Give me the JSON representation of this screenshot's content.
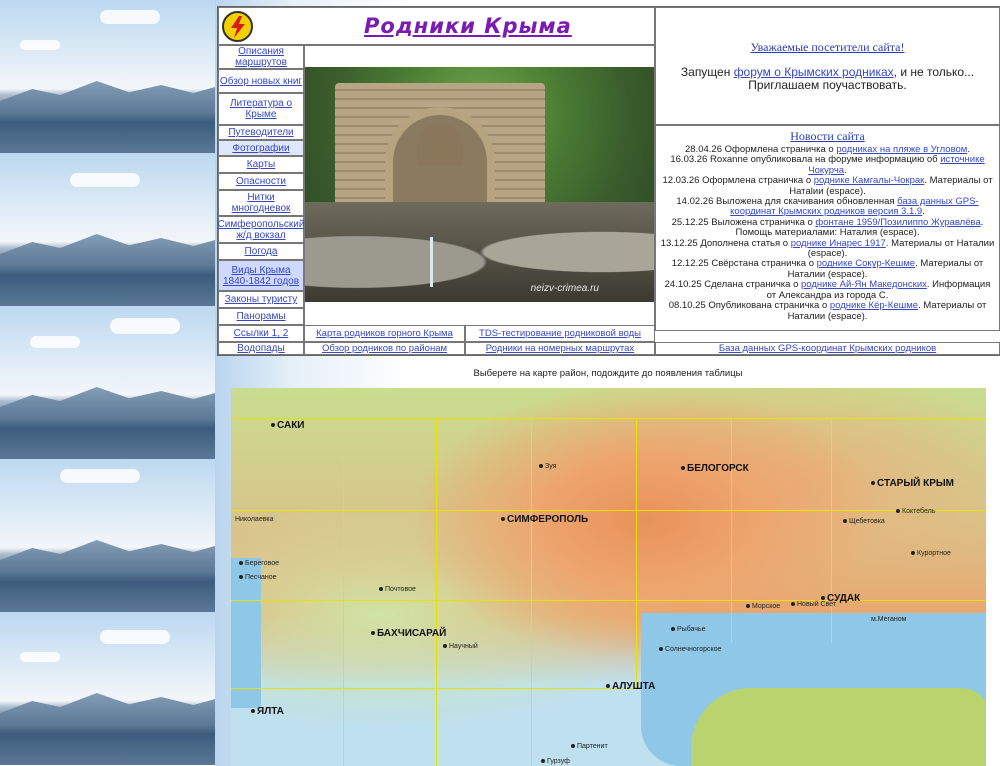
{
  "site": {
    "title": "Родники Крыма"
  },
  "nav": [
    {
      "label": "Описания маршрутов"
    },
    {
      "label": "Обзор новых книг"
    },
    {
      "label": "Литература о Крыме"
    },
    {
      "label": "Путеводители"
    },
    {
      "label": "Фотографии"
    },
    {
      "label": "Карты"
    },
    {
      "label": "Опасности"
    },
    {
      "label": "Нитки многодневок"
    },
    {
      "label": "Симферопольский ж/д вокзал"
    },
    {
      "label": "Погода"
    },
    {
      "label": "Виды Крыма 1840-1842 годов"
    },
    {
      "label": "Законы туристу"
    },
    {
      "label": "Панорамы"
    },
    {
      "label": "Ссылки 1, 2"
    },
    {
      "label": "Водопады"
    }
  ],
  "photo": {
    "watermark": "neizv-crimea.ru"
  },
  "notice": {
    "title": "Уважаемые посетители сайта!",
    "pre": "Запущен ",
    "link": "форум о Крымских родниках",
    "post": ", и не только... Приглашаем поучаствовать."
  },
  "news": {
    "title": "Новости сайта",
    "items": [
      {
        "pre": "28.04.26 Оформлена страничка о ",
        "link": "родниках на пляже в Угловом",
        "post": "."
      },
      {
        "pre": "16.03.26 Roxanne опубликовала на форуме информацию об ",
        "link": "источнике Чокурча",
        "post": "."
      },
      {
        "pre": "12.03.26 Оформлена страничка о ",
        "link": "роднике Камгалы-Чокрак",
        "post": ". Материалы от Натalии (espace)."
      },
      {
        "pre": "14.02.26 Выложена для скачивания обновленная ",
        "link": "база данных GPS-координат Крымских родников версия 3.1.9",
        "post": "."
      },
      {
        "pre": "25.12.25 Выложена страничка о ",
        "link": "фонтане 1959/Позилиппо Журавлёва",
        "post": ". Помощь материалами: Наталия (espace)."
      },
      {
        "pre": "13.12.25 Дополнена статья о ",
        "link": "роднике Инарес 1917",
        "post": ". Материалы от Наталии (espace)."
      },
      {
        "pre": "12.12.25 Свёрстана страничка о ",
        "link": "роднике Сокур-Кешме",
        "post": ". Материалы от Наталии (espace)."
      },
      {
        "pre": "24.10.25 Сделана страничка о ",
        "link": "роднике Ай-Ян Македонских",
        "post": ". Информация от Александра из города С."
      },
      {
        "pre": "08.10.25 Опубликована страничка о ",
        "link": "роднике Кёр-Кешме",
        "post": ". Материалы от Наталии (espace)."
      }
    ]
  },
  "bottom_links": {
    "map_mountain": "Карта родников горного Крыма",
    "tds": "TDS-тестирование родниковой воды",
    "by_region": "Обзор родников по районам",
    "routes": "Родники на номерных маршрутах",
    "gps_db": "База данных GPS-координат Крымских родников"
  },
  "map": {
    "caption": "Выберете на карте район, подождите до появления таблицы",
    "cities": [
      {
        "name": "СИМФЕРОПОЛЬ",
        "big": true
      },
      {
        "name": "БАХЧИСАРАЙ",
        "big": true
      },
      {
        "name": "БЕЛОГОРСК",
        "big": true
      },
      {
        "name": "СТАРЫЙ КРЫМ",
        "big": true
      },
      {
        "name": "СУДАК",
        "big": true
      },
      {
        "name": "АЛУШТА",
        "big": true
      },
      {
        "name": "ЯЛТА",
        "big": true
      },
      {
        "name": "САКИ",
        "big": true
      },
      {
        "name": "Николаевка",
        "big": false
      },
      {
        "name": "Почтовое",
        "big": false
      },
      {
        "name": "Научный",
        "big": false
      },
      {
        "name": "Зуя",
        "big": false
      },
      {
        "name": "Морское",
        "big": false
      },
      {
        "name": "Рыбачье",
        "big": false
      },
      {
        "name": "Солнечногорское",
        "big": false
      },
      {
        "name": "Партенит",
        "big": false
      },
      {
        "name": "Гурзуф",
        "big": false
      },
      {
        "name": "Курортное",
        "big": false
      },
      {
        "name": "Щебетовка",
        "big": false
      },
      {
        "name": "Коктебель",
        "big": false
      },
      {
        "name": "Береговое",
        "big": false
      },
      {
        "name": "Песчаное",
        "big": false
      },
      {
        "name": "м.Меганом",
        "big": false
      },
      {
        "name": "Новый Свет",
        "big": false
      }
    ]
  }
}
